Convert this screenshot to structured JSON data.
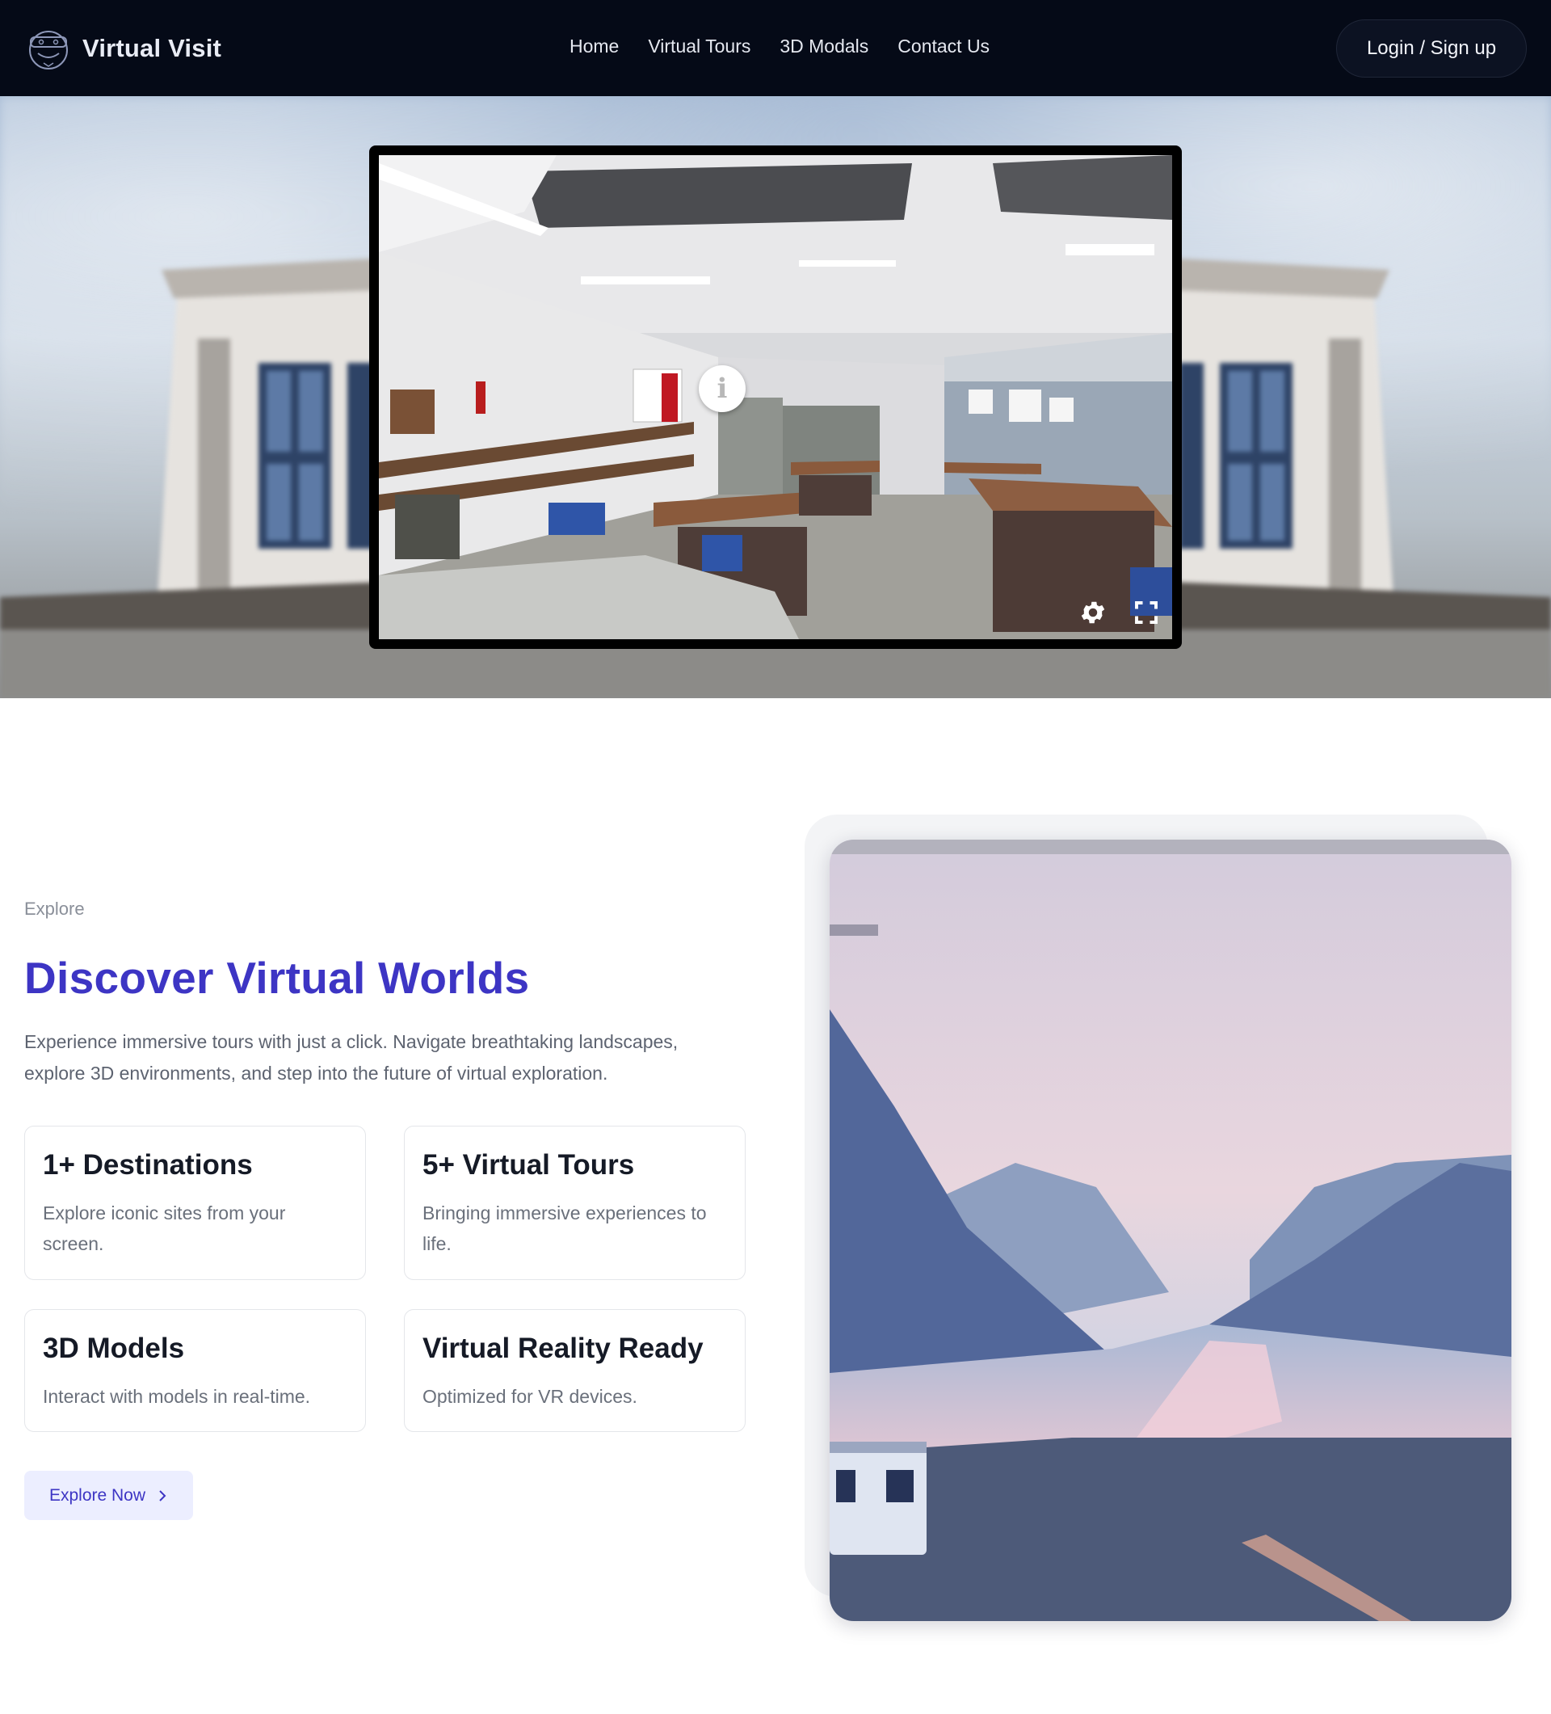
{
  "nav": {
    "brand": "Virtual Visit",
    "brand_icon": "vr-headset-face-icon",
    "links": [
      "Home",
      "Virtual Tours",
      "3D Modals",
      "Contact Us"
    ],
    "login_label": "Login / Sign up"
  },
  "hero": {
    "viewer": {
      "hotspot_glyph": "i",
      "hotspot_icon": "info-icon",
      "controls": [
        "gear-icon",
        "fullscreen-icon"
      ]
    }
  },
  "explore": {
    "eyebrow": "Explore",
    "title": "Discover Virtual Worlds",
    "description": "Experience immersive tours with just a click. Navigate breathtaking landscapes, explore 3D environments, and step into the future of virtual exploration.",
    "stats": [
      {
        "title": "1+ Destinations",
        "text": "Explore iconic sites from your screen."
      },
      {
        "title": "5+ Virtual Tours",
        "text": "Bringing immersive experiences to life."
      },
      {
        "title": "3D Models",
        "text": "Interact with models in real-time."
      },
      {
        "title": "Virtual Reality Ready",
        "text": "Optimized for VR devices."
      }
    ],
    "cta_label": "Explore Now",
    "cta_icon": "chevron-right-icon"
  },
  "colors": {
    "nav_bg": "#050a17",
    "accent": "#3d35c4",
    "cta_bg": "#eceeff"
  }
}
